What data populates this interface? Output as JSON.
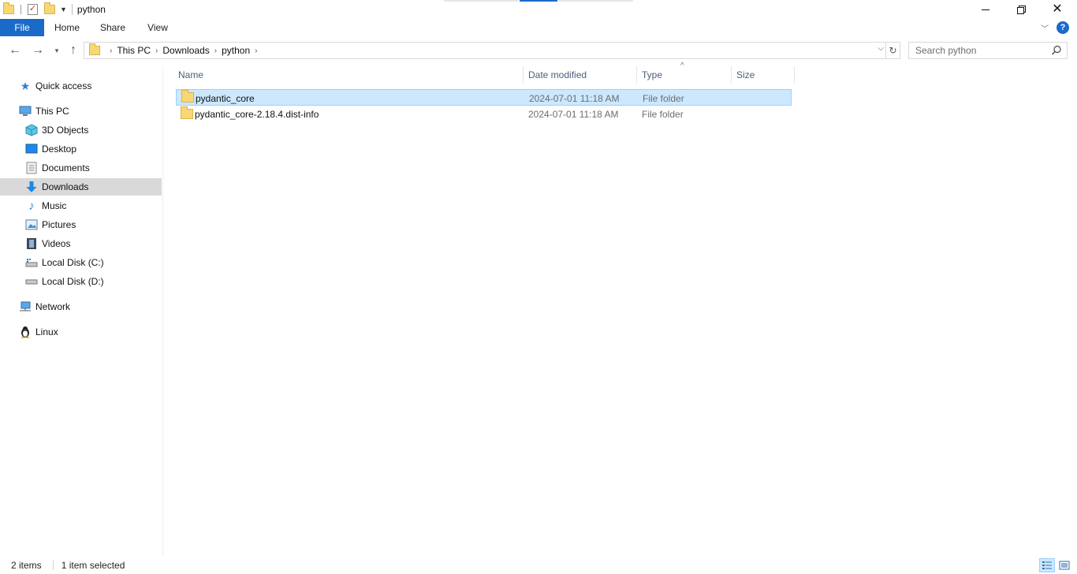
{
  "window": {
    "title": "python"
  },
  "ribbon": {
    "tabs": [
      {
        "label": "File"
      },
      {
        "label": "Home"
      },
      {
        "label": "Share"
      },
      {
        "label": "View"
      }
    ]
  },
  "address": {
    "crumbs": [
      "This PC",
      "Downloads",
      "python"
    ]
  },
  "search": {
    "placeholder": "Search python"
  },
  "sidebar": {
    "items": [
      {
        "label": "Quick access",
        "icon": "star-icon"
      },
      {
        "label": "This PC",
        "icon": "computer-icon"
      },
      {
        "label": "3D Objects",
        "icon": "cube-icon"
      },
      {
        "label": "Desktop",
        "icon": "desktop-icon"
      },
      {
        "label": "Documents",
        "icon": "document-icon"
      },
      {
        "label": "Downloads",
        "icon": "download-arrow-icon",
        "selected": true
      },
      {
        "label": "Music",
        "icon": "music-note-icon"
      },
      {
        "label": "Pictures",
        "icon": "picture-icon"
      },
      {
        "label": "Videos",
        "icon": "film-icon"
      },
      {
        "label": "Local Disk (C:)",
        "icon": "drive-icon"
      },
      {
        "label": "Local Disk (D:)",
        "icon": "drive-icon"
      },
      {
        "label": "Network",
        "icon": "network-icon"
      },
      {
        "label": "Linux",
        "icon": "penguin-icon"
      }
    ]
  },
  "columns": {
    "name": "Name",
    "date": "Date modified",
    "type": "Type",
    "size": "Size"
  },
  "files": [
    {
      "name": "pydantic_core",
      "date": "2024-07-01 11:18 AM",
      "type": "File folder",
      "size": "",
      "selected": true
    },
    {
      "name": "pydantic_core-2.18.4.dist-info",
      "date": "2024-07-01 11:18 AM",
      "type": "File folder",
      "size": "",
      "selected": false
    }
  ],
  "status": {
    "items": "2 items",
    "selected": "1 item selected"
  },
  "colors": {
    "accent": "#1b6ac9",
    "selection": "#cce8ff",
    "selection_border": "#99d1ff",
    "folder": "#f8d775"
  }
}
